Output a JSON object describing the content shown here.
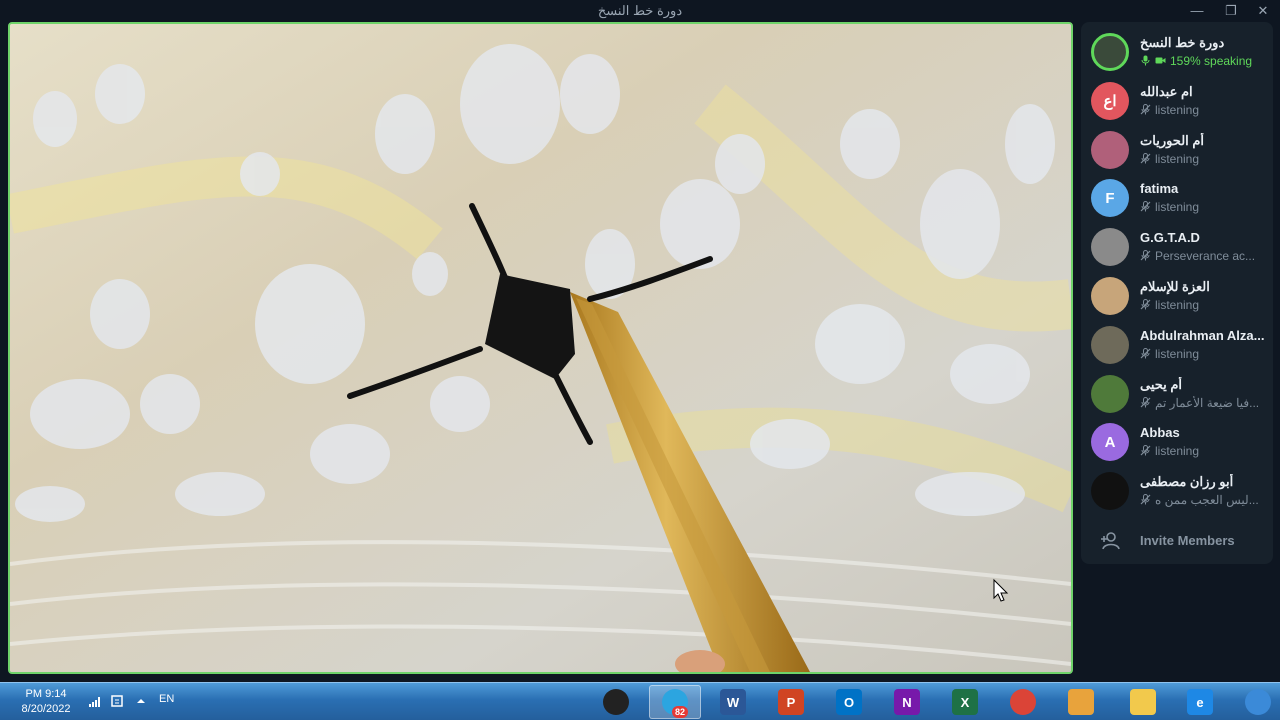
{
  "window": {
    "title": "دورة خط النسخ",
    "minimize_glyph": "—",
    "restore_glyph": "❐",
    "close_glyph": "✕"
  },
  "members": [
    {
      "name": "دورة خط النسخ",
      "status": "159% speaking",
      "speaking": true,
      "avatar_text": "",
      "avatar_color": "#3a4a3a"
    },
    {
      "name": "ام عبدالله",
      "status": "listening",
      "speaking": false,
      "avatar_text": "اع",
      "avatar_color": "#e2565e"
    },
    {
      "name": "أم الحوريات",
      "status": "listening",
      "speaking": false,
      "avatar_text": "",
      "avatar_color": "#b0607a"
    },
    {
      "name": "fatima",
      "status": "listening",
      "speaking": false,
      "avatar_text": "F",
      "avatar_color": "#5aa7e6"
    },
    {
      "name": "G.G.T.A.D",
      "status": "Perseverance ac...",
      "speaking": false,
      "avatar_text": "",
      "avatar_color": "#8a8a8a"
    },
    {
      "name": "العزة للإسلام",
      "status": "listening",
      "speaking": false,
      "avatar_text": "",
      "avatar_color": "#c7a57a"
    },
    {
      "name": "Abdulrahman Alza...",
      "status": "listening",
      "speaking": false,
      "avatar_text": "",
      "avatar_color": "#6e6a5a"
    },
    {
      "name": "أم يحيى",
      "status": "فيا ضيعة الأعمار تم...",
      "speaking": false,
      "avatar_text": "",
      "avatar_color": "#4f7a3a"
    },
    {
      "name": "Abbas",
      "status": "listening",
      "speaking": false,
      "avatar_text": "A",
      "avatar_color": "#9a6ae0"
    },
    {
      "name": "أبو رزان مصطفى",
      "status": "ليس العجب ممن ه...",
      "speaking": false,
      "avatar_text": "",
      "avatar_color": "#111111"
    }
  ],
  "invite": {
    "label": "Invite Members"
  },
  "taskbar": {
    "time": "PM 9:14",
    "date": "8/20/2022",
    "language": "EN",
    "telegram_badge": "82",
    "apps": [
      {
        "name": "obs",
        "letter": "",
        "color": "#222222"
      },
      {
        "name": "telegram",
        "letter": "",
        "color": "#2ca5e0"
      },
      {
        "name": "word",
        "letter": "W",
        "color": "#2b5797"
      },
      {
        "name": "powerpoint",
        "letter": "P",
        "color": "#d04423"
      },
      {
        "name": "outlook",
        "letter": "O",
        "color": "#0072c6"
      },
      {
        "name": "onenote",
        "letter": "N",
        "color": "#7719aa"
      },
      {
        "name": "excel",
        "letter": "X",
        "color": "#1e7145"
      },
      {
        "name": "chrome",
        "letter": "",
        "color": "#db4437"
      },
      {
        "name": "media-player",
        "letter": "",
        "color": "#e8a33c"
      },
      {
        "name": "file-explorer",
        "letter": "",
        "color": "#f2c94c"
      },
      {
        "name": "internet-explorer",
        "letter": "e",
        "color": "#1e88e5"
      },
      {
        "name": "start",
        "letter": "",
        "color": "#3b8ad8"
      }
    ]
  },
  "colors": {
    "speaking_green": "#5fd85a",
    "video_border": "#6fd36a",
    "panel_bg": "#17212b"
  }
}
